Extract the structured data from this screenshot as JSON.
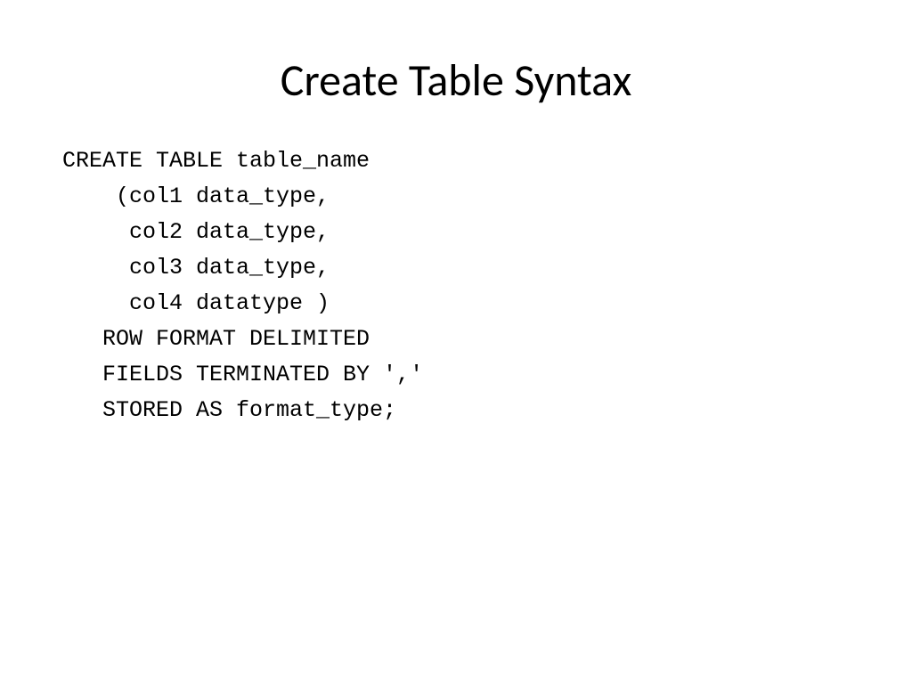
{
  "slide": {
    "title": "Create Table Syntax",
    "code": {
      "line1": "CREATE TABLE table_name",
      "line2": "    (col1 data_type,",
      "line3": "     col2 data_type,",
      "line4": "     col3 data_type,",
      "line5": "     col4 datatype )",
      "line6": "   ROW FORMAT DELIMITED",
      "line7": "   FIELDS TERMINATED BY ','",
      "line8": "   STORED AS format_type;"
    }
  }
}
